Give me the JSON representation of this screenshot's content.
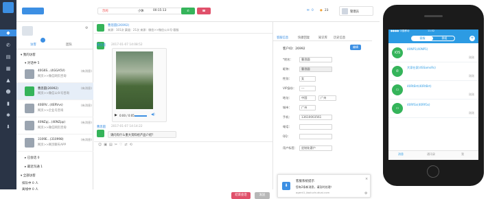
{
  "topbar": {
    "status_label": "示闲",
    "status_busy": "小休",
    "timer": "00:15:13",
    "mail_count": "0",
    "bell_count": "23",
    "user_label": "管理员"
  },
  "sidebar": {
    "tabs": [
      "访客",
      "团队"
    ],
    "groups": {
      "active": "我的访客",
      "pending": "对话中 5",
      "waiting": "已会话 0",
      "recent": "最近沟通 1",
      "all": "全部访客",
      "queue": "排队中 0 人",
      "leave": "离线中 0 人"
    },
    "items": [
      {
        "title": "40G6S...(4GGA5V)",
        "sub": "网页>>微信网页咨询",
        "right": "(有消息)",
        "color": "#999"
      },
      {
        "title": "曹思圆(26992)",
        "sub": "网页>>微信公众号咨询",
        "right": "(有消息)",
        "color": "#35b45a"
      },
      {
        "title": "40ERV...(4ERVvs)",
        "sub": "网页>>企业号咨询",
        "right": "(有消息)",
        "color": "#999"
      },
      {
        "title": "40NZpj...(40NZpp)",
        "sub": "网页>>微信网页咨询",
        "right": "(有消息)",
        "color": "#999"
      },
      {
        "title": "3109E...(310998)",
        "sub": "网页>>网页聊天APP",
        "right": "(有消息)",
        "color": "#999"
      }
    ]
  },
  "chat": {
    "header_name": "曹思圆(26992)",
    "header_sub": "来源：101次  渠道：21次  来源：微信>>微信公众号-客服",
    "msg1_name": "曹思圆",
    "msg1_time": "2017-01-07 14:08:52",
    "video_time": "0:00 / 0:05",
    "msg2_name": "曹思圆",
    "msg2_time": "2017-01-07 14:14:22",
    "msg2_text": "请问有什么重大资料给产品介绍？",
    "btn_end": "结束会话",
    "btn_send": "发送"
  },
  "info": {
    "tabs": [
      "客服信息",
      "快捷回复",
      "知识库",
      "历史信息"
    ],
    "uid_label": "客户ID：26992",
    "edit": "编辑",
    "fields": [
      {
        "label": "*姓名：",
        "value": "曹思圆"
      },
      {
        "label": "昵称：",
        "value": "曹思圆"
      },
      {
        "label": "性别：",
        "value": "女"
      },
      {
        "label": "VIP身份：",
        "value": "---"
      },
      {
        "label": "地址：",
        "value": "中国"
      },
      {
        "label": "城市：",
        "value": "广州"
      },
      {
        "label": "手机：",
        "value": "13610003561"
      },
      {
        "label": "电话：",
        "value": ""
      },
      {
        "label": "QQ：",
        "value": ""
      },
      {
        "label": "用户标签：",
        "value": "定制化客户"
      }
    ],
    "toast_title": "客服系统提示",
    "toast_body": "您有2条新消息，请及时处理！",
    "toast_link": "agent1.jiaoluchuduai.com"
  },
  "phone": {
    "status_left": "●●●● 中国移动",
    "status_time": "11:52",
    "tab1": "客服",
    "tab2": "群组",
    "items": [
      {
        "name": "40NP1(40NP1)",
        "time": "刚刚",
        "icon": "iOS"
      },
      {
        "name": "大家在家(4SSamsRs)",
        "time": "刚刚",
        "icon": "W"
      },
      {
        "name": "40RtBrt(40RtBrt)",
        "time": "刚刚",
        "icon": "W"
      },
      {
        "name": "40RfGs(40RfGs)",
        "time": "刚刚",
        "icon": "W"
      }
    ],
    "nav": [
      "消息",
      "通讯录",
      "我"
    ]
  }
}
